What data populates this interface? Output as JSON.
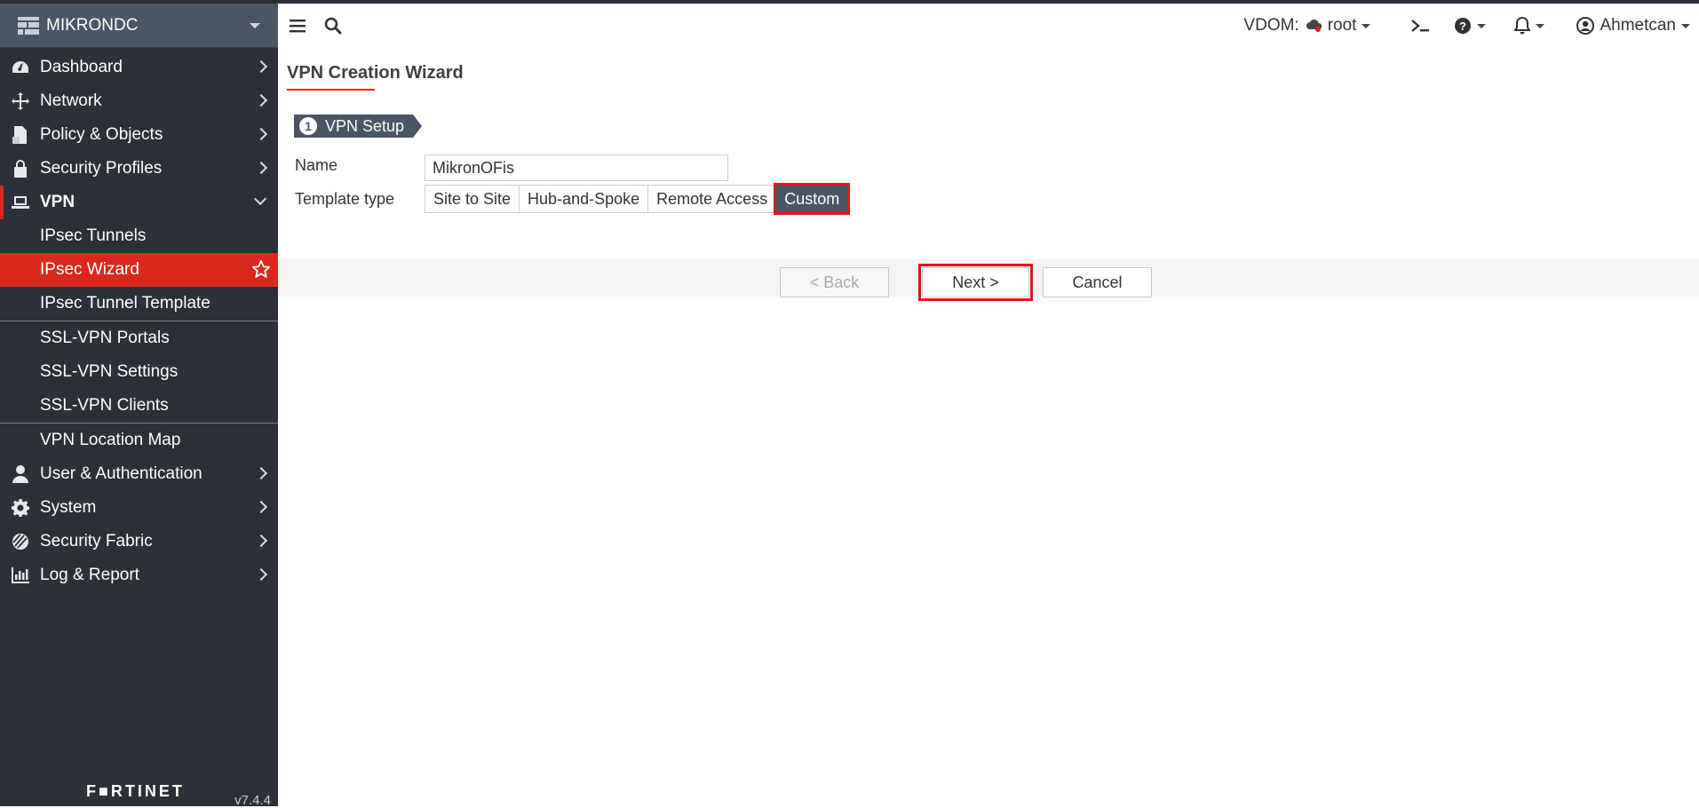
{
  "sidebar": {
    "brand": "MIKRONDC",
    "items": [
      {
        "label": "Dashboard",
        "icon": "dashboard-icon"
      },
      {
        "label": "Network",
        "icon": "network-icon"
      },
      {
        "label": "Policy & Objects",
        "icon": "policy-icon"
      },
      {
        "label": "Security Profiles",
        "icon": "lock-icon"
      },
      {
        "label": "VPN",
        "icon": "laptop-icon"
      }
    ],
    "vpn_sub": [
      "IPsec Tunnels",
      "IPsec Wizard",
      "IPsec Tunnel Template",
      "SSL-VPN Portals",
      "SSL-VPN Settings",
      "SSL-VPN Clients",
      "VPN Location Map"
    ],
    "items_after": [
      {
        "label": "User & Authentication",
        "icon": "user-icon"
      },
      {
        "label": "System",
        "icon": "gear-icon"
      },
      {
        "label": "Security Fabric",
        "icon": "fabric-icon"
      },
      {
        "label": "Log & Report",
        "icon": "chart-icon"
      }
    ],
    "footer_logo": "F■RTINET",
    "version": "v7.4.4"
  },
  "topbar": {
    "vdom_label": "VDOM:",
    "vdom_value": "root",
    "user": "Ahmetcan"
  },
  "main": {
    "title": "VPN Creation Wizard",
    "step_number": "1",
    "step_label": "VPN Setup",
    "name_label": "Name",
    "name_value": "MikronOFis",
    "template_label": "Template type",
    "template_options": [
      "Site to Site",
      "Hub-and-Spoke",
      "Remote Access",
      "Custom"
    ],
    "template_selected": "Custom",
    "back_label": "< Back",
    "next_label": "Next >",
    "cancel_label": "Cancel"
  },
  "colors": {
    "accent": "#da291c",
    "sidebar_bg": "#2c3137",
    "brand_bg": "#4a5566",
    "highlight_box": "#e0161b"
  }
}
